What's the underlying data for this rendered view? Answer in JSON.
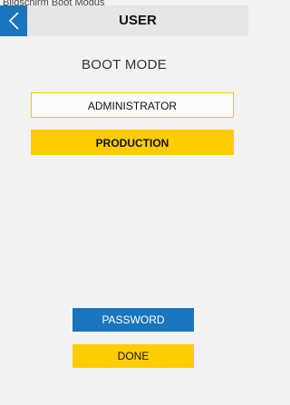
{
  "window": {
    "title": "Bildschirm Boot Modus"
  },
  "header": {
    "title": "USER",
    "back_icon": "chevron-left-icon"
  },
  "boot_mode": {
    "title": "BOOT MODE",
    "options": [
      {
        "label": "ADMINISTRATOR",
        "selected": false
      },
      {
        "label": "PRODUCTION",
        "selected": true
      }
    ]
  },
  "actions": {
    "password_label": "PASSWORD",
    "done_label": "DONE"
  },
  "colors": {
    "primary_blue": "#1b75bc",
    "accent_yellow": "#ffcc00",
    "background": "#f3f3f3",
    "header_background": "#e6e6e6"
  }
}
